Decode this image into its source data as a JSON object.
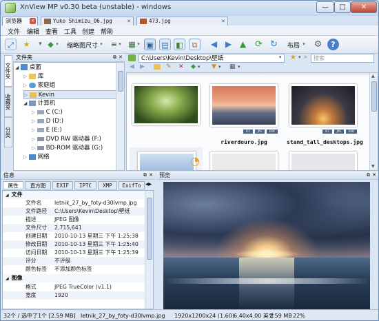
{
  "window": {
    "title": "XnView MP v0.30 beta (unstable) - windows",
    "min": "—",
    "max": "□",
    "close": "✕"
  },
  "tabs": [
    {
      "label": "浏览器",
      "close": "✕"
    },
    {
      "label": "Yuko Shimizu_06.jpg",
      "close": "✕"
    },
    {
      "label": "473.jpg",
      "close": "✕"
    }
  ],
  "menu": [
    "文件",
    "编辑",
    "查看",
    "工具",
    "创建",
    "帮助"
  ],
  "toolbar": {
    "thumbsize_label": "缩略图尺寸",
    "layout_label": "布局"
  },
  "folder_panel": {
    "title": "文件夹",
    "side_tabs": [
      "文件夹",
      "收藏夹",
      "分类"
    ],
    "items": [
      "桌面",
      "库",
      "家庭组",
      "Kevin",
      "计算机",
      "C (C:)",
      "D (D:)",
      "E (E:)",
      "DVD RW 驱动器 (F:)",
      "BD-ROM 驱动器 (G:)",
      "网络"
    ]
  },
  "address": {
    "path": "C:\\Users\\Kevin\\Desktop\\壁纸",
    "search_placeholder": "搜索"
  },
  "thumbnails": [
    {
      "caption": ""
    },
    {
      "caption": "riverdouro.jpg"
    },
    {
      "caption": "stand_tall_desktops.jpg"
    }
  ],
  "thumb_badges": [
    "ICC",
    "JPG",
    "EXIF"
  ],
  "info_panel": {
    "title": "信息",
    "tabs": [
      "属性",
      "直方图",
      "EXIF",
      "IPTC",
      "XMP",
      "ExifTo"
    ],
    "sections": [
      {
        "name": "文件",
        "rows": [
          {
            "k": "文件名",
            "v": "letnik_27_by_foty-d30lvmp.jpg"
          },
          {
            "k": "文件路径",
            "v": "C:\\Users\\Kevin\\Desktop\\壁纸"
          },
          {
            "k": "描述",
            "v": "JPEG 图像"
          },
          {
            "k": "文件尺寸",
            "v": "2,715,641"
          },
          {
            "k": "创建日期",
            "v": "2010-10-13 星期三 下午 1:25:38"
          },
          {
            "k": "修改日期",
            "v": "2010-10-13 星期三 下午 1:25:40"
          },
          {
            "k": "访问日期",
            "v": "2010-10-13 星期三 下午 1:25:39"
          },
          {
            "k": "评分",
            "v": "不评级"
          },
          {
            "k": "颜色标签",
            "v": "不添加颜色标签"
          }
        ]
      },
      {
        "name": "图像",
        "rows": [
          {
            "k": "格式",
            "v": "JPEG TrueColor (v1.1)"
          },
          {
            "k": "宽度",
            "v": "1920"
          }
        ]
      }
    ]
  },
  "preview_panel": {
    "title": "预览"
  },
  "status": {
    "count": "32个 / 选中了1个 [2.59 MB]",
    "filename": "letnik_27_by_foty-d30lvmp.jpg",
    "dims": "1920x1200x24 (1.60)",
    "size_in": "6.40x4.00 英寸",
    "mb": "2.59 MB",
    "zoom": "22%"
  },
  "colors": {
    "accent": "#3d6fb0",
    "pane_border": "#a8bbd3",
    "title_bar": "#c4d7ee"
  }
}
